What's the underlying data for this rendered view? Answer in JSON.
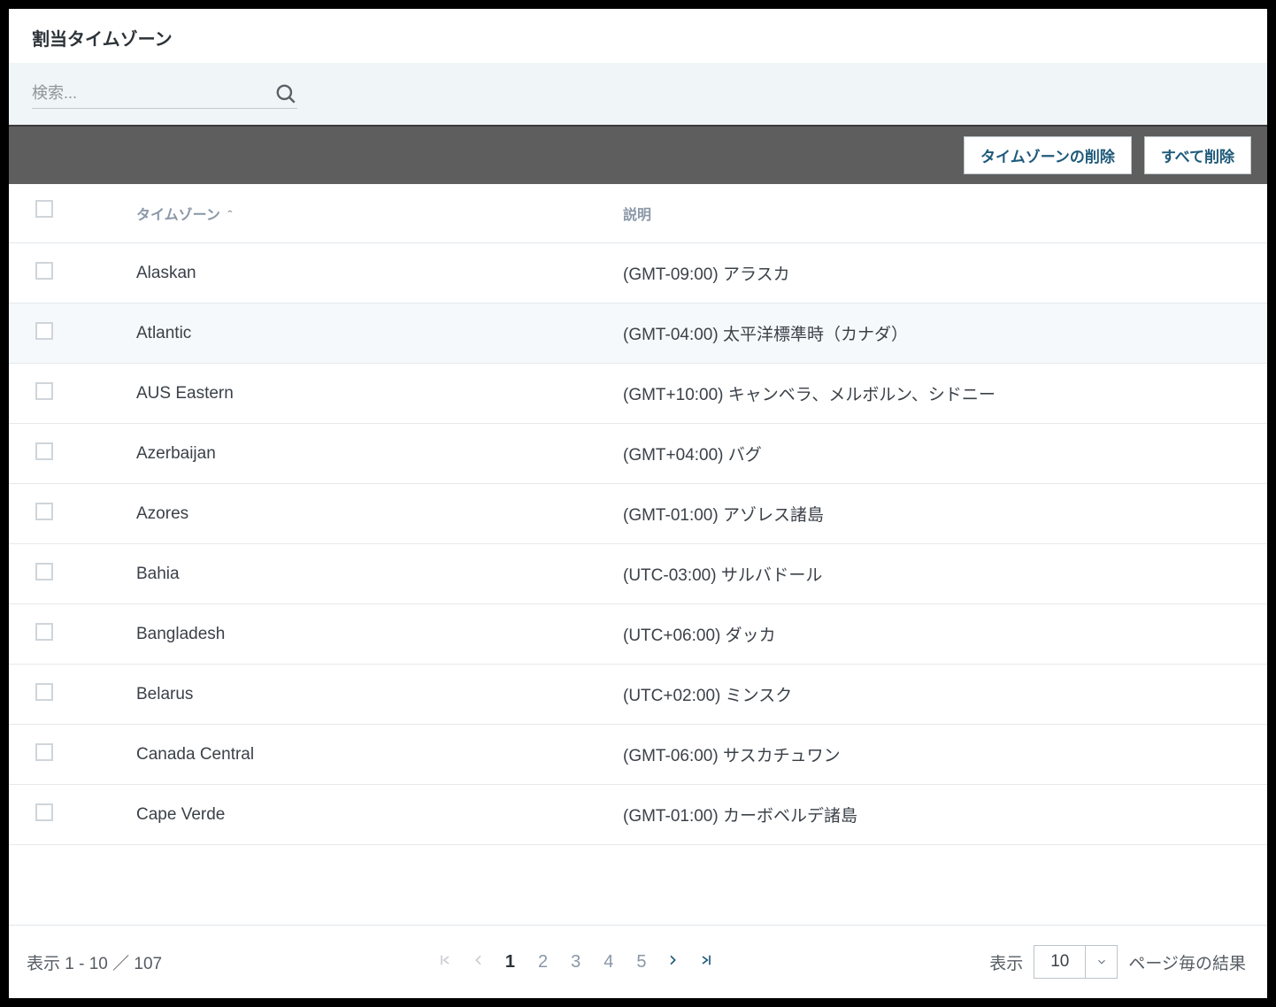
{
  "title": "割当タイムゾーン",
  "search": {
    "placeholder": "検索..."
  },
  "actions": {
    "delete_timezone": "タイムゾーンの削除",
    "delete_all": "すべて削除"
  },
  "columns": {
    "name": "タイムゾーン",
    "desc": "説明"
  },
  "rows": [
    {
      "name": "Alaskan",
      "desc": "(GMT-09:00) アラスカ",
      "highlight": false
    },
    {
      "name": "Atlantic",
      "desc": "(GMT-04:00) 太平洋標準時（カナダ）",
      "highlight": true
    },
    {
      "name": "AUS Eastern",
      "desc": "(GMT+10:00) キャンベラ、メルボルン、シドニー",
      "highlight": false
    },
    {
      "name": "Azerbaijan",
      "desc": "(GMT+04:00) バグ",
      "highlight": false
    },
    {
      "name": "Azores",
      "desc": "(GMT-01:00) アゾレス諸島",
      "highlight": false
    },
    {
      "name": "Bahia",
      "desc": "(UTC-03:00) サルバドール",
      "highlight": false
    },
    {
      "name": "Bangladesh",
      "desc": "(UTC+06:00) ダッカ",
      "highlight": false
    },
    {
      "name": "Belarus",
      "desc": "(UTC+02:00) ミンスク",
      "highlight": false
    },
    {
      "name": "Canada Central",
      "desc": "(GMT-06:00) サスカチュワン",
      "highlight": false
    },
    {
      "name": "Cape Verde",
      "desc": "(GMT-01:00) カーボベルデ諸島",
      "highlight": false
    }
  ],
  "footer": {
    "range": "表示 1 - 10 ／ 107",
    "pages": [
      "1",
      "2",
      "3",
      "4",
      "5"
    ],
    "active_page": "1",
    "per_page_prefix": "表示",
    "per_page_value": "10",
    "per_page_suffix": "ページ毎の結果"
  }
}
